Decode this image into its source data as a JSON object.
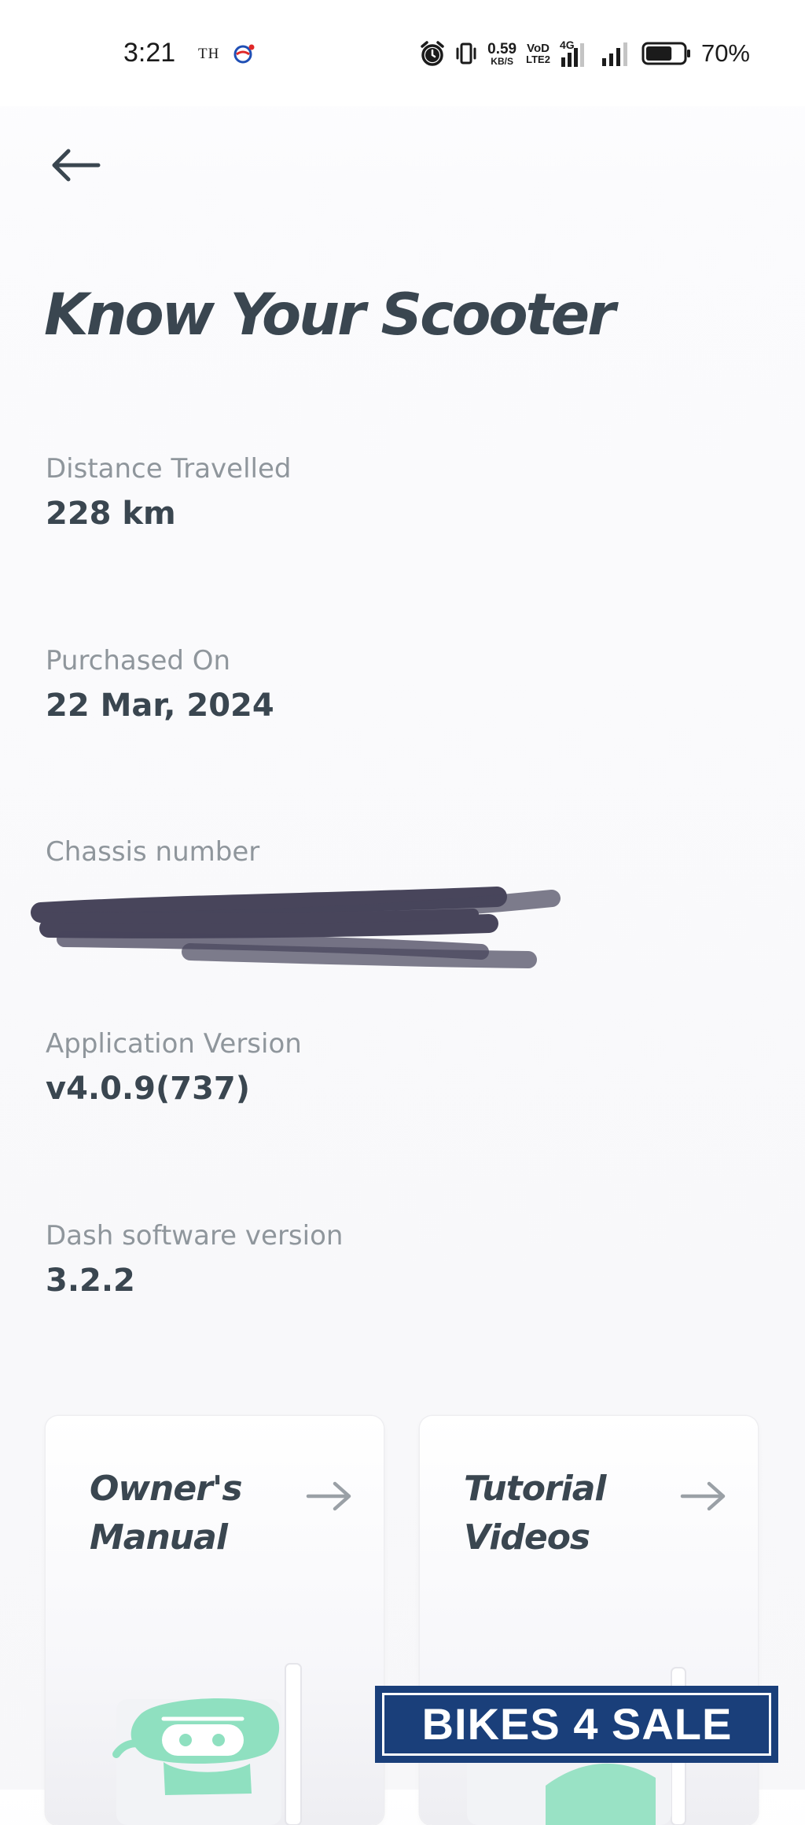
{
  "status_bar": {
    "time": "3:21",
    "carrier": "TH",
    "net_speed_value": "0.59",
    "net_speed_unit": "KB/S",
    "volte_top": "VoD",
    "volte_bottom": "LTE2",
    "network_type": "4G",
    "battery_percent": "70%",
    "battery_level": 0.7
  },
  "header": {
    "title": "Know Your Scooter"
  },
  "info": {
    "distance": {
      "label": "Distance Travelled",
      "value": "228 km"
    },
    "purchased": {
      "label": "Purchased On",
      "value": "22 Mar, 2024"
    },
    "chassis": {
      "label": "Chassis number",
      "value": ""
    },
    "app_version": {
      "label": "Application Version",
      "value": "v4.0.9(737)"
    },
    "dash_version": {
      "label": "Dash software version",
      "value": "3.2.2"
    }
  },
  "cards": [
    {
      "line1": "Owner's",
      "line2": "Manual"
    },
    {
      "line1": "Tutorial",
      "line2": "Videos"
    }
  ],
  "watermark": {
    "text": "BIKES 4 SALE"
  },
  "icons": {
    "back": "arrow-left-icon",
    "card_arrow": "arrow-right-icon",
    "alarm": "alarm-clock-icon",
    "vibrate": "vibrate-icon",
    "signal": "signal-bars-icon",
    "battery": "battery-icon"
  },
  "colors": {
    "title": "#3a4650",
    "label": "#8f969c",
    "value": "#3a4650",
    "accent_mint": "#8fe0c0",
    "watermark_bg": "#1a3f7a"
  }
}
